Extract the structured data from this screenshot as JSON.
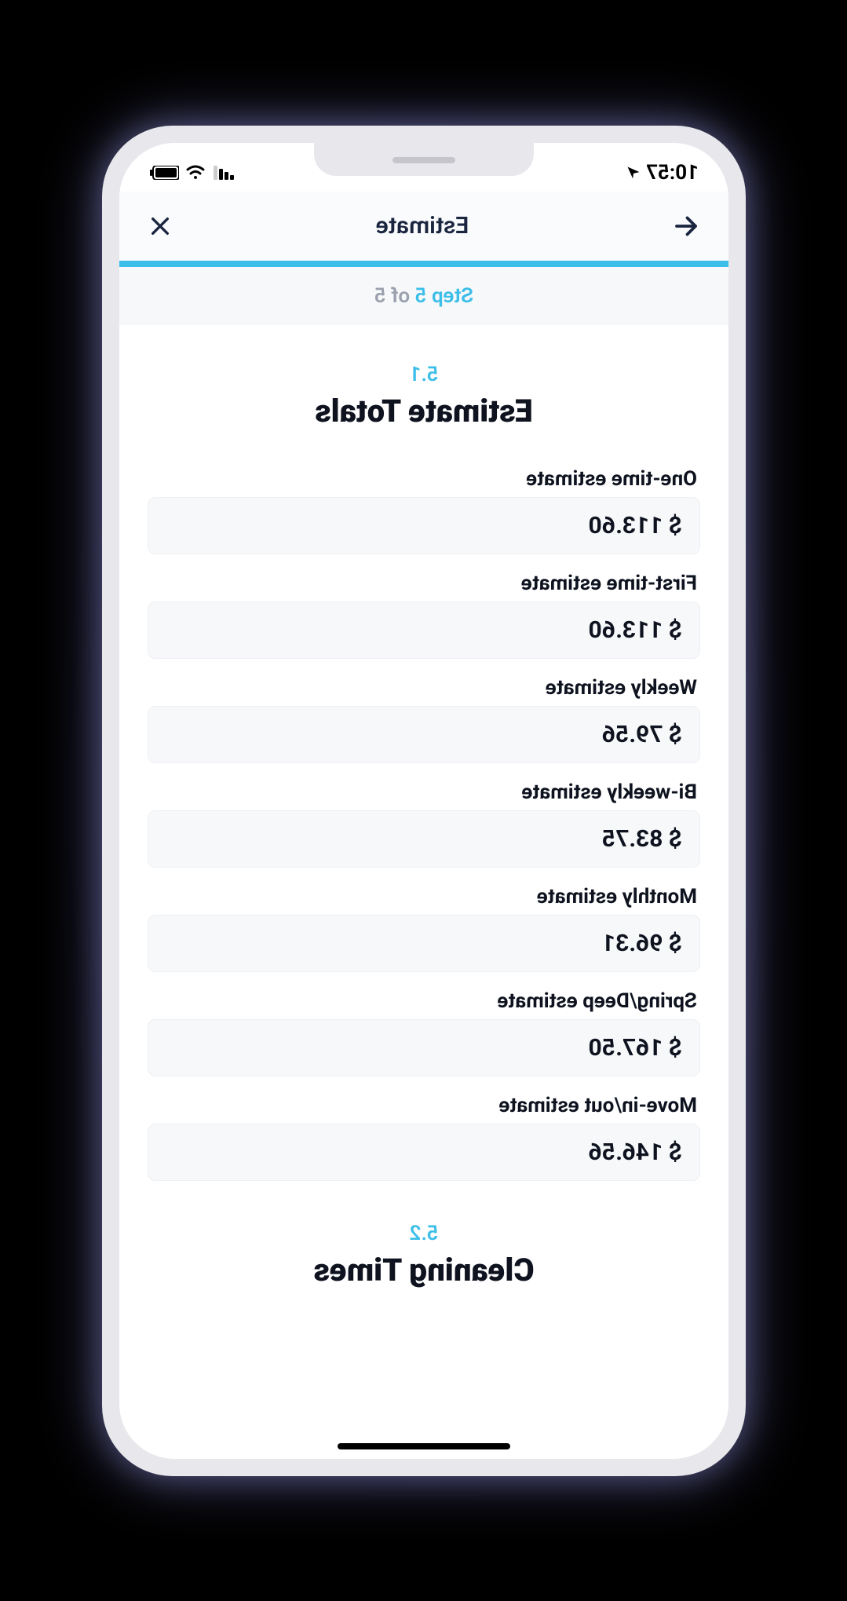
{
  "status_bar": {
    "time": "10:57"
  },
  "header": {
    "title": "Estimate"
  },
  "step": {
    "prefix": "Step ",
    "current": "5",
    "of": " of ",
    "total": "5"
  },
  "section1": {
    "number": "5.1",
    "title": "Estimate Totals"
  },
  "estimates": [
    {
      "label": "One-time estimate",
      "value": "$ 113.60"
    },
    {
      "label": "First-time estimate",
      "value": "$ 113.60"
    },
    {
      "label": "Weekly estimate",
      "value": "$ 79.56"
    },
    {
      "label": "Bi-weekly estimate",
      "value": "$ 83.75"
    },
    {
      "label": "Monthly estimate",
      "value": "$ 96.31"
    },
    {
      "label": "Spring/Deep estimate",
      "value": "$ 167.50"
    },
    {
      "label": "Move-in/out estimate",
      "value": "$ 146.56"
    }
  ],
  "section2": {
    "number": "5.2",
    "title": "Cleaning Times"
  }
}
